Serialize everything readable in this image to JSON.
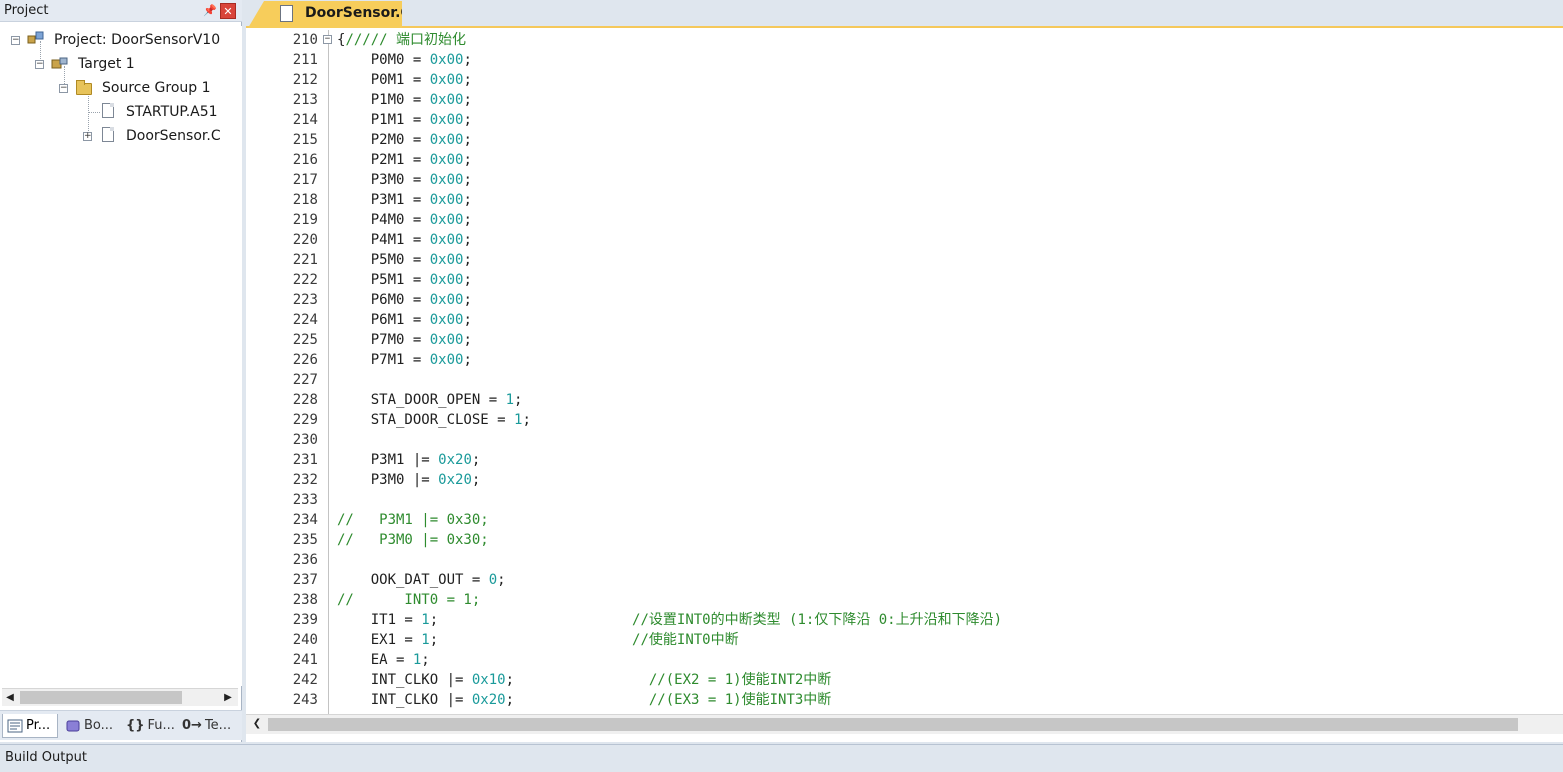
{
  "project_panel": {
    "title": "Project",
    "tree": {
      "project": "Project: DoorSensorV10",
      "target": "Target 1",
      "group": "Source Group 1",
      "files": [
        "STARTUP.A51",
        "DoorSensor.C"
      ]
    },
    "tabs": [
      "Pr...",
      "Bo...",
      "Fu...",
      "Te..."
    ]
  },
  "editor": {
    "active_tab": "DoorSensor.C",
    "lines": [
      {
        "n": "210",
        "code": [
          {
            "t": "{",
            "c": ""
          },
          {
            "t": "///// 端口初始化",
            "c": "cmt"
          }
        ]
      },
      {
        "n": "211",
        "code": [
          {
            "t": "    P0M0 = ",
            "c": ""
          },
          {
            "t": "0x00",
            "c": "num"
          },
          {
            "t": ";",
            "c": ""
          }
        ]
      },
      {
        "n": "212",
        "code": [
          {
            "t": "    P0M1 = ",
            "c": ""
          },
          {
            "t": "0x00",
            "c": "num"
          },
          {
            "t": ";",
            "c": ""
          }
        ]
      },
      {
        "n": "213",
        "code": [
          {
            "t": "    P1M0 = ",
            "c": ""
          },
          {
            "t": "0x00",
            "c": "num"
          },
          {
            "t": ";",
            "c": ""
          }
        ]
      },
      {
        "n": "214",
        "code": [
          {
            "t": "    P1M1 = ",
            "c": ""
          },
          {
            "t": "0x00",
            "c": "num"
          },
          {
            "t": ";",
            "c": ""
          }
        ]
      },
      {
        "n": "215",
        "code": [
          {
            "t": "    P2M0 = ",
            "c": ""
          },
          {
            "t": "0x00",
            "c": "num"
          },
          {
            "t": ";",
            "c": ""
          }
        ]
      },
      {
        "n": "216",
        "code": [
          {
            "t": "    P2M1 = ",
            "c": ""
          },
          {
            "t": "0x00",
            "c": "num"
          },
          {
            "t": ";",
            "c": ""
          }
        ]
      },
      {
        "n": "217",
        "code": [
          {
            "t": "    P3M0 = ",
            "c": ""
          },
          {
            "t": "0x00",
            "c": "num"
          },
          {
            "t": ";",
            "c": ""
          }
        ]
      },
      {
        "n": "218",
        "code": [
          {
            "t": "    P3M1 = ",
            "c": ""
          },
          {
            "t": "0x00",
            "c": "num"
          },
          {
            "t": ";",
            "c": ""
          }
        ]
      },
      {
        "n": "219",
        "code": [
          {
            "t": "    P4M0 = ",
            "c": ""
          },
          {
            "t": "0x00",
            "c": "num"
          },
          {
            "t": ";",
            "c": ""
          }
        ]
      },
      {
        "n": "220",
        "code": [
          {
            "t": "    P4M1 = ",
            "c": ""
          },
          {
            "t": "0x00",
            "c": "num"
          },
          {
            "t": ";",
            "c": ""
          }
        ]
      },
      {
        "n": "221",
        "code": [
          {
            "t": "    P5M0 = ",
            "c": ""
          },
          {
            "t": "0x00",
            "c": "num"
          },
          {
            "t": ";",
            "c": ""
          }
        ]
      },
      {
        "n": "222",
        "code": [
          {
            "t": "    P5M1 = ",
            "c": ""
          },
          {
            "t": "0x00",
            "c": "num"
          },
          {
            "t": ";",
            "c": ""
          }
        ]
      },
      {
        "n": "223",
        "code": [
          {
            "t": "    P6M0 = ",
            "c": ""
          },
          {
            "t": "0x00",
            "c": "num"
          },
          {
            "t": ";",
            "c": ""
          }
        ]
      },
      {
        "n": "224",
        "code": [
          {
            "t": "    P6M1 = ",
            "c": ""
          },
          {
            "t": "0x00",
            "c": "num"
          },
          {
            "t": ";",
            "c": ""
          }
        ]
      },
      {
        "n": "225",
        "code": [
          {
            "t": "    P7M0 = ",
            "c": ""
          },
          {
            "t": "0x00",
            "c": "num"
          },
          {
            "t": ";",
            "c": ""
          }
        ]
      },
      {
        "n": "226",
        "code": [
          {
            "t": "    P7M1 = ",
            "c": ""
          },
          {
            "t": "0x00",
            "c": "num"
          },
          {
            "t": ";",
            "c": ""
          }
        ]
      },
      {
        "n": "227",
        "code": []
      },
      {
        "n": "228",
        "code": [
          {
            "t": "    STA_DOOR_OPEN = ",
            "c": ""
          },
          {
            "t": "1",
            "c": "num"
          },
          {
            "t": ";",
            "c": ""
          }
        ]
      },
      {
        "n": "229",
        "code": [
          {
            "t": "    STA_DOOR_CLOSE = ",
            "c": ""
          },
          {
            "t": "1",
            "c": "num"
          },
          {
            "t": ";",
            "c": ""
          }
        ]
      },
      {
        "n": "230",
        "code": []
      },
      {
        "n": "231",
        "code": [
          {
            "t": "    P3M1 |= ",
            "c": ""
          },
          {
            "t": "0x20",
            "c": "num"
          },
          {
            "t": ";",
            "c": ""
          }
        ]
      },
      {
        "n": "232",
        "code": [
          {
            "t": "    P3M0 |= ",
            "c": ""
          },
          {
            "t": "0x20",
            "c": "num"
          },
          {
            "t": ";",
            "c": ""
          }
        ]
      },
      {
        "n": "233",
        "code": []
      },
      {
        "n": "234",
        "code": [
          {
            "t": "//   P3M1 |= 0x30;",
            "c": "cmt"
          }
        ]
      },
      {
        "n": "235",
        "code": [
          {
            "t": "//   P3M0 |= 0x30;",
            "c": "cmt"
          }
        ]
      },
      {
        "n": "236",
        "code": []
      },
      {
        "n": "237",
        "code": [
          {
            "t": "    OOK_DAT_OUT = ",
            "c": ""
          },
          {
            "t": "0",
            "c": "num"
          },
          {
            "t": ";",
            "c": ""
          }
        ]
      },
      {
        "n": "238",
        "code": [
          {
            "t": "//      INT0 = 1;",
            "c": "cmt"
          }
        ]
      },
      {
        "n": "239",
        "code": [
          {
            "t": "    IT1 = ",
            "c": ""
          },
          {
            "t": "1",
            "c": "num"
          },
          {
            "t": ";                       ",
            "c": ""
          },
          {
            "t": "//设置INT0的中断类型 (1:仅下降沿 0:上升沿和下降沿)",
            "c": "cmt"
          }
        ]
      },
      {
        "n": "240",
        "code": [
          {
            "t": "    EX1 = ",
            "c": ""
          },
          {
            "t": "1",
            "c": "num"
          },
          {
            "t": ";                       ",
            "c": ""
          },
          {
            "t": "//使能INT0中断",
            "c": "cmt"
          }
        ]
      },
      {
        "n": "241",
        "code": [
          {
            "t": "    EA = ",
            "c": ""
          },
          {
            "t": "1",
            "c": "num"
          },
          {
            "t": ";",
            "c": ""
          }
        ]
      },
      {
        "n": "242",
        "code": [
          {
            "t": "    INT_CLKO |= ",
            "c": ""
          },
          {
            "t": "0x10",
            "c": "num"
          },
          {
            "t": ";                ",
            "c": ""
          },
          {
            "t": "//(EX2 = 1)使能INT2中断",
            "c": "cmt"
          }
        ]
      },
      {
        "n": "243",
        "code": [
          {
            "t": "    INT_CLKO |= ",
            "c": ""
          },
          {
            "t": "0x20",
            "c": "num"
          },
          {
            "t": ";                ",
            "c": ""
          },
          {
            "t": "//(EX3 = 1)使能INT3中断",
            "c": "cmt"
          }
        ]
      }
    ]
  },
  "build_output": {
    "label": "Build Output"
  },
  "colors": {
    "number": "#1a9a9a",
    "comment": "#2e8b2e",
    "tab_accent": "#f7cd5b"
  }
}
